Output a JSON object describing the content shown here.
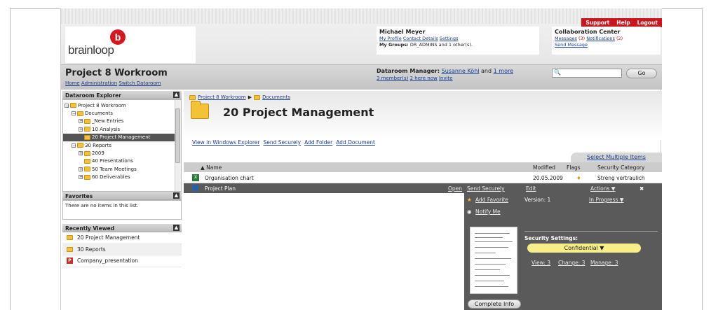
{
  "toplinks": {
    "support": "Support",
    "help": "Help",
    "logout": "Logout"
  },
  "brand": {
    "logo_letter": "b",
    "name": "brainloop"
  },
  "user": {
    "name": "Michael Meyer",
    "profile": "My Profile",
    "contact": "Contact Details",
    "settings": "Settings",
    "groups_label": "My Groups:",
    "groups_value": "DR_ADMINS and 1 other(s)."
  },
  "collab": {
    "title": "Collaboration Center",
    "messages": "Messages",
    "messages_count": "(3)",
    "notifications": "Notifications",
    "notifications_count": "(2)",
    "send_message": "Send Message"
  },
  "workroom": {
    "title": "Project 8 Workroom",
    "home": "Home",
    "administration": "Administration",
    "switch": "Switch Dataroom",
    "dm_label": "Dataroom Manager:",
    "dm_name": "Susanne Köhl",
    "dm_and": "and",
    "dm_more": "1 more",
    "members": "3 member(s)",
    "here_now": "2 here now",
    "invite": "Invite",
    "go": "Go"
  },
  "explorer": {
    "title": "Dataroom Explorer",
    "nodes": [
      {
        "label": "Project 8 Workroom",
        "toggle": "⊟"
      },
      {
        "label": "Documents",
        "toggle": "⊟"
      },
      {
        "label": "_New Entries",
        "toggle": "⊞"
      },
      {
        "label": "10 Analysis",
        "toggle": "⊞"
      },
      {
        "label": "20 Project Management",
        "toggle": ""
      },
      {
        "label": "30 Reports",
        "toggle": "⊟"
      },
      {
        "label": "2009",
        "toggle": "⊞"
      },
      {
        "label": "40 Presentations",
        "toggle": ""
      },
      {
        "label": "50 Team Meetings",
        "toggle": "⊞"
      },
      {
        "label": "60 Deliverables",
        "toggle": "⊞"
      }
    ]
  },
  "favorites": {
    "title": "Favorites",
    "empty": "There are no items in this list."
  },
  "recent": {
    "title": "Recently Viewed",
    "items": [
      "20 Project Management",
      "30 Reports",
      "Company_presentation"
    ]
  },
  "main": {
    "crumb_root": "Project 8 Workroom",
    "crumb_arrow": "▶",
    "crumb_child": "Documents",
    "title": "20 Project Management",
    "view_explorer": "View in Windows Explorer",
    "send_securely": "Send Securely",
    "add_folder": "Add Folder",
    "add_document": "Add Document",
    "select_multiple": "Select Multiple Items",
    "col_name": "▲ Name",
    "col_modified": "Modified",
    "col_flags": "Flags",
    "col_security": "Security Category",
    "row_name": "Organisation chart",
    "row_modified": "20.05.2009",
    "row_security": "Streng vertraulich"
  },
  "detail": {
    "name": "Project Plan",
    "open": "Open",
    "send_securely": "Send Securely",
    "edit": "Edit",
    "actions": "Actions ▼",
    "add_favorite": "Add Favorite",
    "version": "Version: 1",
    "status": "In Progress ▼",
    "notify": "Notify Me",
    "security_title": "Security Settings:",
    "confidential": "Confidential ▼",
    "view": "View: 3",
    "change": "Change: 3",
    "manage": "Manage: 3",
    "complete": "Complete Info"
  }
}
